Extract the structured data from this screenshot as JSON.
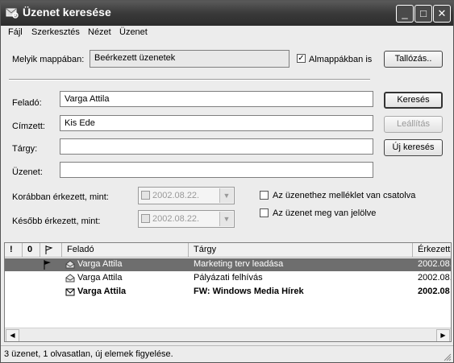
{
  "window": {
    "title": "Üzenet keresése",
    "controls": {
      "minimize": "_",
      "maximize": "□",
      "close": "✕"
    }
  },
  "menu": [
    "Fájl",
    "Szerkesztés",
    "Nézet",
    "Üzenet"
  ],
  "folder": {
    "label": "Melyik mappában:",
    "value": "Beérkezett üzenetek",
    "subfolders_label": "Almappákban is",
    "subfolders_checked": true,
    "browse_label": "Tallózás.."
  },
  "fields": [
    {
      "label": "Feladó:",
      "value": "Varga Attila"
    },
    {
      "label": "Címzett:",
      "value": "Kis Ede"
    },
    {
      "label": "Tárgy:",
      "value": ""
    },
    {
      "label": "Üzenet:",
      "value": ""
    }
  ],
  "buttons": {
    "search": "Keresés",
    "reset": "Leállítás",
    "new_search": "Új keresés"
  },
  "dates": [
    {
      "label": "Korábban érkezett, mint:",
      "value": "2002.08.22."
    },
    {
      "label": "Később érkezett, mint:",
      "value": "2002.08.22."
    }
  ],
  "options": [
    {
      "label": "Az üzenethez melléklet van csatolva",
      "checked": false
    },
    {
      "label": "Az üzenet meg van jelölve",
      "checked": false
    }
  ],
  "list": {
    "headers": {
      "priority": "!",
      "attachment": "0",
      "flag": "",
      "from": "Feladó",
      "subject": "Tárgy",
      "received": "Érkezett"
    },
    "rows": [
      {
        "flagged": true,
        "from": "Varga Attila",
        "subject": "Marketing terv leadása",
        "received": "2002.08.",
        "selected": true,
        "unread": false
      },
      {
        "flagged": false,
        "from": "Varga Attila",
        "subject": "Pályázati felhívás",
        "received": "2002.08.",
        "selected": false,
        "unread": false
      },
      {
        "flagged": false,
        "from": "Varga Attila",
        "subject": "FW: Windows Media Hírek",
        "received": "2002.08",
        "selected": false,
        "unread": true
      }
    ]
  },
  "status": "3 üzenet, 1 olvasatlan, új elemek figyelése."
}
